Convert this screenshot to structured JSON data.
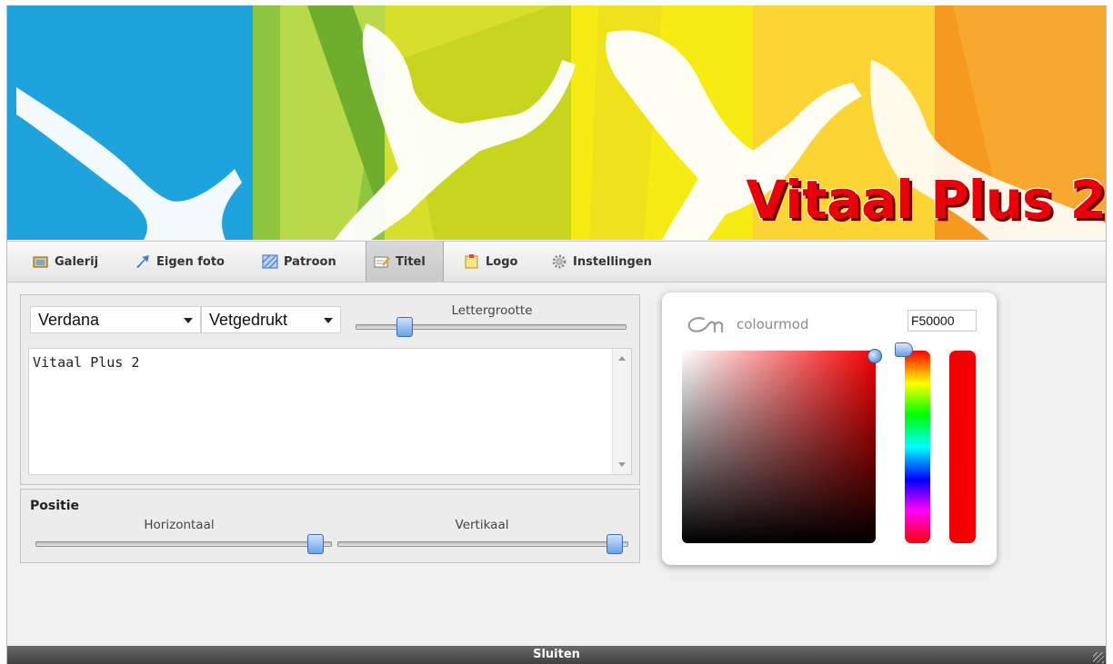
{
  "banner": {
    "title": "Vitaal Plus 2"
  },
  "tabs": [
    {
      "label": "Galerij",
      "icon": "gallery-icon"
    },
    {
      "label": "Eigen foto",
      "icon": "upload-arrow-icon"
    },
    {
      "label": "Patroon",
      "icon": "pattern-icon"
    },
    {
      "label": "Titel",
      "icon": "title-pencil-icon",
      "active": true
    },
    {
      "label": "Logo",
      "icon": "logo-note-icon"
    },
    {
      "label": "Instellingen",
      "icon": "gear-icon"
    }
  ],
  "title_panel": {
    "font_select": "Verdana",
    "style_select": "Vetgedrukt",
    "size_label": "Lettergrootte",
    "size_slider_value": 0.16,
    "text_value": "Vitaal Plus 2"
  },
  "position_panel": {
    "title": "Positie",
    "horizontal_label": "Horizontaal",
    "vertical_label": "Vertikaal",
    "horizontal_value": 0.97,
    "vertical_value": 0.98
  },
  "colour_picker": {
    "brand": "colourmod",
    "hex": "F50000",
    "selected_color": "#f50000"
  },
  "footer": {
    "close_label": "Sluiten"
  }
}
